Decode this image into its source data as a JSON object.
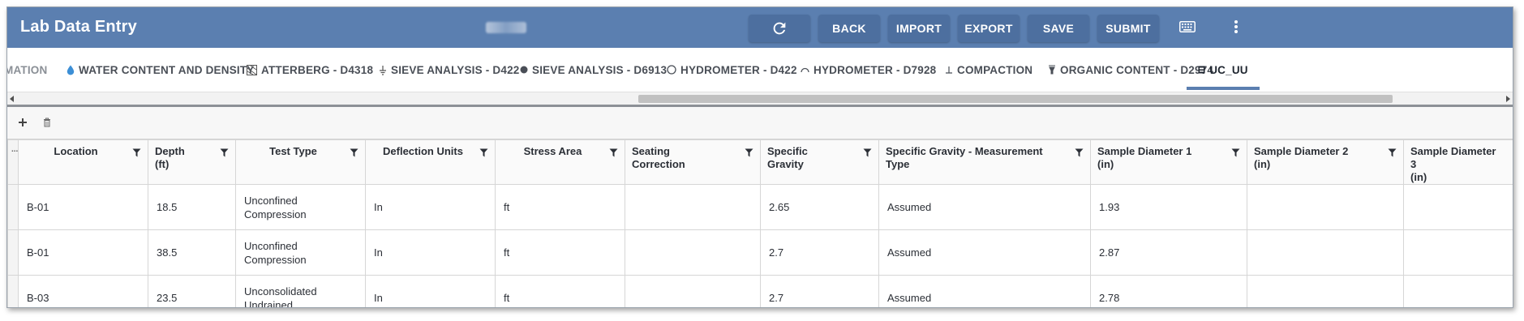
{
  "header": {
    "title": "Lab Data Entry",
    "buttons": {
      "back": "BACK",
      "import": "IMPORT",
      "export": "EXPORT",
      "save": "SAVE",
      "submit": "SUBMIT"
    },
    "icons": [
      "refresh-icon",
      "keyboard-icon",
      "more-vert-icon"
    ]
  },
  "tabs": [
    {
      "label": "MATION",
      "icon": "none"
    },
    {
      "label": "WATER CONTENT AND DENSITY",
      "icon": "droplet-icon"
    },
    {
      "label": "ATTERBERG - D4318",
      "icon": "atterberg-icon"
    },
    {
      "label": "SIEVE ANALYSIS - D422",
      "icon": "sieve-icon"
    },
    {
      "label": "SIEVE ANALYSIS - D6913",
      "icon": "dot-icon"
    },
    {
      "label": "HYDROMETER - D422",
      "icon": "circle-icon"
    },
    {
      "label": "HYDROMETER - D7928",
      "icon": "arc-icon"
    },
    {
      "label": "COMPACTION",
      "icon": "perpendicular-icon"
    },
    {
      "label": "ORGANIC CONTENT - D2974",
      "icon": "flask-icon"
    },
    {
      "label": "UC_UU",
      "icon": "uc-icon",
      "active": true
    }
  ],
  "toolbar": {
    "add_icon": "plus-icon",
    "delete_icon": "trash-icon"
  },
  "grid": {
    "handle_header": "...",
    "columns": [
      "Location",
      "Depth (ft)",
      "Test Type",
      "Deflection Units",
      "Stress Area",
      "Seating Correction",
      "Specific Gravity",
      "Specific Gravity - Measurement Type",
      "Sample Diameter 1 (in)",
      "Sample Diameter 2 (in)",
      "Sample Diameter 3 (in)"
    ],
    "column_lines": [
      [
        "Location"
      ],
      [
        "Depth",
        "(ft)"
      ],
      [
        "Test Type"
      ],
      [
        "Deflection Units"
      ],
      [
        "Stress Area"
      ],
      [
        "Seating",
        "Correction"
      ],
      [
        "Specific",
        "Gravity"
      ],
      [
        "Specific Gravity - Measurement",
        "Type"
      ],
      [
        "Sample Diameter 1",
        "(in)"
      ],
      [
        "Sample Diameter 2",
        "(in)"
      ],
      [
        "Sample Diameter 3",
        "(in)"
      ]
    ],
    "rows": [
      {
        "location": "B-01",
        "depth": "18.5",
        "test_type": [
          "Unconfined",
          "Compression"
        ],
        "deflection_units": "In",
        "stress_area": "ft",
        "seating_correction": "",
        "specific_gravity": "2.65",
        "sg_measurement_type": "Assumed",
        "sample_diameter_1": "1.93",
        "sample_diameter_2": "",
        "sample_diameter_3": ""
      },
      {
        "location": "B-01",
        "depth": "38.5",
        "test_type": [
          "Unconfined",
          "Compression"
        ],
        "deflection_units": "In",
        "stress_area": "ft",
        "seating_correction": "",
        "specific_gravity": "2.7",
        "sg_measurement_type": "Assumed",
        "sample_diameter_1": "2.87",
        "sample_diameter_2": "",
        "sample_diameter_3": ""
      },
      {
        "location": "B-03",
        "depth": "23.5",
        "test_type": [
          "Unconsolidated",
          "Undrained"
        ],
        "deflection_units": "In",
        "stress_area": "ft",
        "seating_correction": "",
        "specific_gravity": "2.7",
        "sg_measurement_type": "Assumed",
        "sample_diameter_1": "2.78",
        "sample_diameter_2": "",
        "sample_diameter_3": ""
      }
    ]
  },
  "colors": {
    "header_bg": "#5b7fb0",
    "button_bg": "#4d6f9f",
    "tab_underline": "#5b7fb0"
  }
}
